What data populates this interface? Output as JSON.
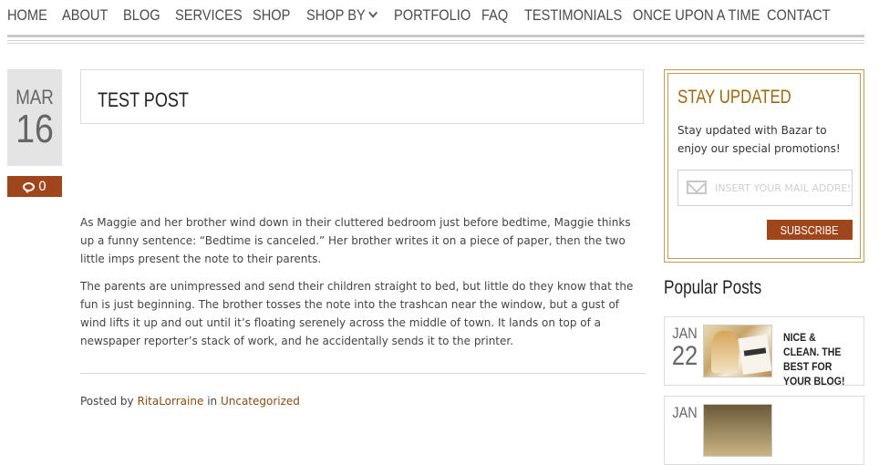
{
  "nav": {
    "items": [
      "HOME",
      "ABOUT",
      "BLOG",
      "SERVICES",
      "SHOP",
      "SHOP BY",
      "PORTFOLIO",
      "FAQ",
      "TESTIMONIALS",
      "ONCE UPON A TIME",
      "CONTACT"
    ],
    "dropdown_icon": "chevron-down-icon"
  },
  "post": {
    "date_month": "MAR",
    "date_day": "16",
    "comment_count": "0",
    "comment_icon": "speech-bubble-icon",
    "title": "TEST POST",
    "paragraphs": [
      "As Maggie and her brother wind down in their cluttered bedroom just before bedtime, Maggie thinks up a funny sentence: “Bedtime is canceled.” Her brother writes it on a piece of paper, then the two little imps present the note to their parents.",
      "The parents are unimpressed and send their children straight to bed, but little do they know that the fun is just beginning. The brother tosses the note into the trashcan near the window, but a gust of wind lifts it up and out until it’s floating serenely across the middle of town. It lands on top of a newspaper reporter’s stack of work, and he accidentally sends it to the printer."
    ],
    "posted_by_label": "Posted by",
    "author": "RitaLorraine",
    "in_label": "in",
    "category": "Uncategorized"
  },
  "sidebar": {
    "newsletter": {
      "title": "STAY UPDATED",
      "text": "Stay updated with Bazar to enjoy our special promotions!",
      "placeholder": "INSERT YOUR MAIL ADDRESS",
      "mail_icon": "envelope-icon",
      "button": "SUBSCRIBE"
    },
    "popular": {
      "title": "Popular Posts",
      "items": [
        {
          "month": "JAN",
          "day": "22",
          "title": "NICE & CLEAN. THE BEST FOR YOUR BLOG!"
        },
        {
          "month": "JAN",
          "day": "",
          "title": ""
        }
      ]
    }
  },
  "colors": {
    "accent": "#a0461c",
    "gold": "#9a6a10",
    "link": "#8a4b10"
  }
}
